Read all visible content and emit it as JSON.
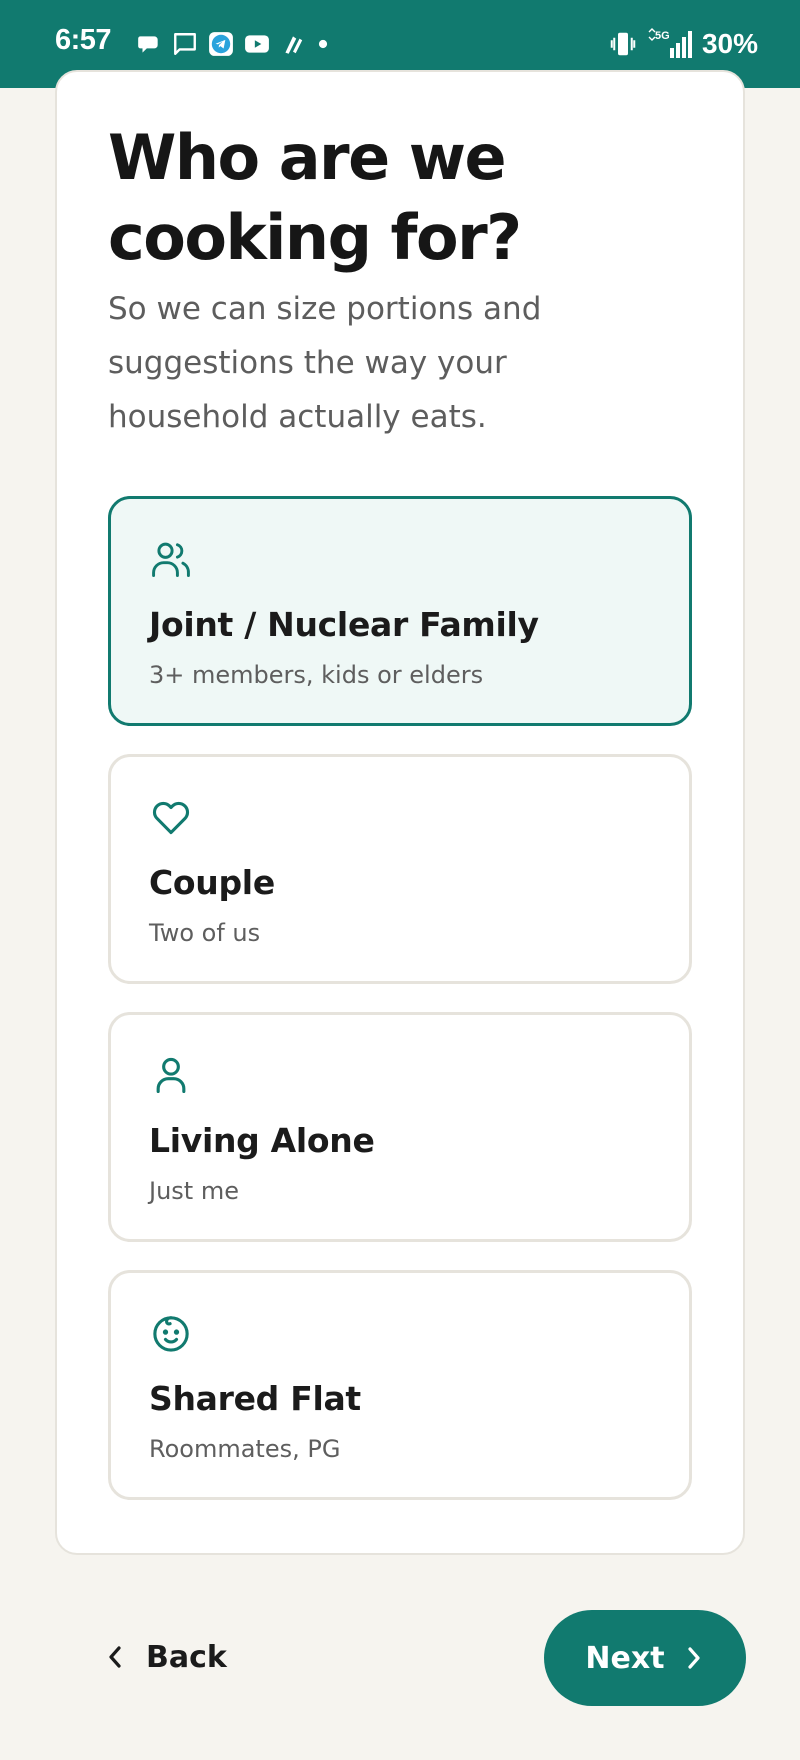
{
  "status_bar": {
    "time": "6:57",
    "battery": "30%",
    "network": "5G",
    "icons_left": [
      "chat-bubble-icon",
      "message-icon",
      "telegram-icon",
      "youtube-icon",
      "app-icon",
      "dot-icon"
    ],
    "icons_right": [
      "vibrate-icon",
      "signal-icon"
    ],
    "background_color": "#117a6f"
  },
  "header": {
    "title": "Who are we cooking for?",
    "subtitle": "So we can size portions and suggestions the way your household actually eats."
  },
  "options": [
    {
      "icon": "users-icon",
      "title": "Joint / Nuclear Family",
      "description": "3+ members, kids or elders",
      "selected": true
    },
    {
      "icon": "heart-icon",
      "title": "Couple",
      "description": "Two of us",
      "selected": false
    },
    {
      "icon": "user-icon",
      "title": "Living Alone",
      "description": "Just me",
      "selected": false
    },
    {
      "icon": "smiley-icon",
      "title": "Shared Flat",
      "description": "Roommates, PG",
      "selected": false
    }
  ],
  "navigation": {
    "back_label": "Back",
    "next_label": "Next"
  },
  "colors": {
    "accent": "#117a6f",
    "selected_background": "#eff8f6",
    "card_border": "#e6e3dc",
    "page_background": "#f6f4ef"
  }
}
